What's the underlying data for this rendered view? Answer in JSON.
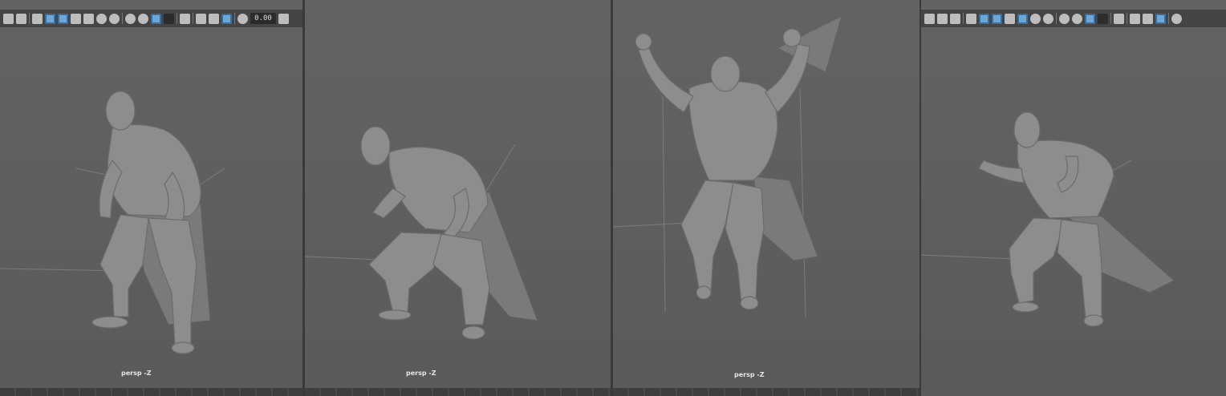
{
  "viewports": [
    {
      "camera_label": "persp -Z",
      "toolbar_value": "0.00"
    },
    {
      "camera_label": "persp -Z"
    },
    {
      "camera_label": "persp -Z"
    },
    {
      "camera_label": ""
    }
  ],
  "colors": {
    "background": "#5d5d5d",
    "toolbar": "#444444",
    "active_button": "#6fa6d6"
  }
}
